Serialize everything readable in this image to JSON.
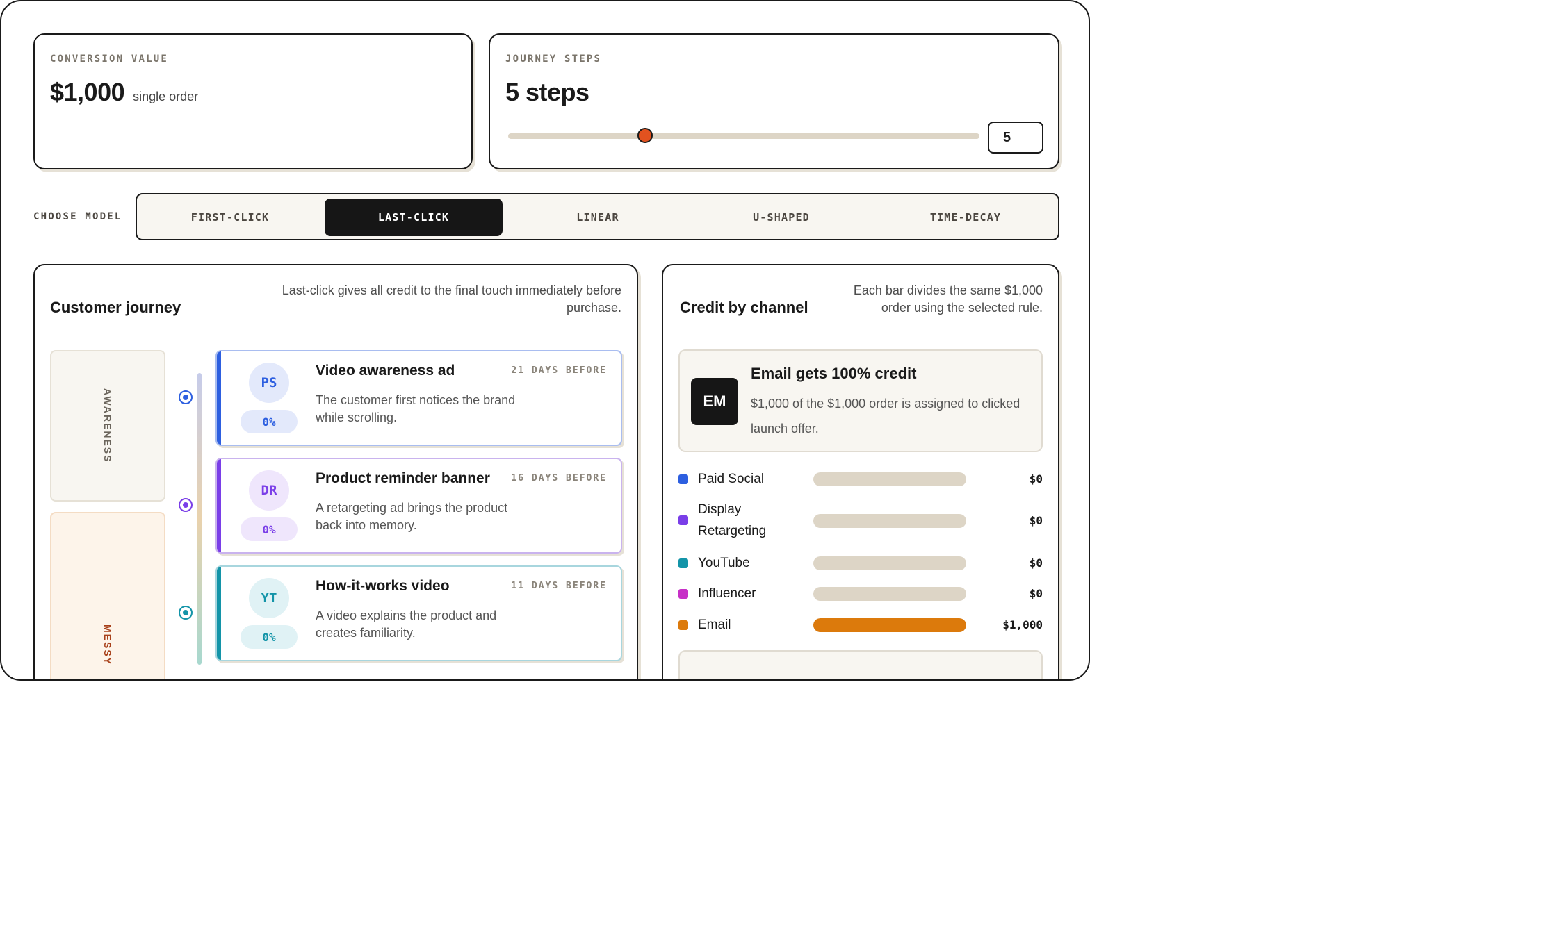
{
  "conversion": {
    "label": "CONVERSION VALUE",
    "value": "$1,000",
    "note": "single order"
  },
  "journey_steps": {
    "label": "JOURNEY STEPS",
    "value": "5 steps",
    "input": "5",
    "slider_fraction": 0.29
  },
  "models": {
    "label": "CHOOSE MODEL",
    "tabs": [
      "FIRST-CLICK",
      "LAST-CLICK",
      "LINEAR",
      "U-SHAPED",
      "TIME-DECAY"
    ],
    "active": "LAST-CLICK"
  },
  "journey": {
    "title": "Customer journey",
    "desc": "Last-click gives all credit to the final touch immediately before purchase.",
    "stages": [
      "AWARENESS",
      "MESSY"
    ],
    "steps": [
      {
        "initials": "PS",
        "pct": "0%",
        "title": "Video awareness ad",
        "desc": "The customer first notices the brand while scrolling.",
        "days": "21 DAYS BEFORE",
        "color": "#2d5fe0"
      },
      {
        "initials": "DR",
        "pct": "0%",
        "title": "Product reminder banner",
        "desc": "A retargeting ad brings the product back into memory.",
        "days": "16 DAYS BEFORE",
        "color": "#7a3ee8"
      },
      {
        "initials": "YT",
        "pct": "0%",
        "title": "How-it-works video",
        "desc": "A video explains the product and creates familiarity.",
        "days": "11 DAYS BEFORE",
        "color": "#1394a8"
      }
    ]
  },
  "credit": {
    "title": "Credit by channel",
    "desc": "Each bar divides the same $1,000 order using the selected rule.",
    "hero_badge": "EM",
    "hero_title": "Email gets 100% credit",
    "hero_desc": "$1,000 of the $1,000 order is assigned to clicked launch offer.",
    "channels": [
      {
        "name": "Paid Social",
        "value": "$0",
        "share": 0,
        "color": "#2d5fe0"
      },
      {
        "name": "Display Retargeting",
        "value": "$0",
        "share": 0,
        "color": "#7a3ee8"
      },
      {
        "name": "YouTube",
        "value": "$0",
        "share": 0,
        "color": "#1394a8"
      },
      {
        "name": "Influencer",
        "value": "$0",
        "share": 0,
        "color": "#c730c7"
      },
      {
        "name": "Email",
        "value": "$1,000",
        "share": 1,
        "color": "#dc7a0c"
      }
    ]
  }
}
